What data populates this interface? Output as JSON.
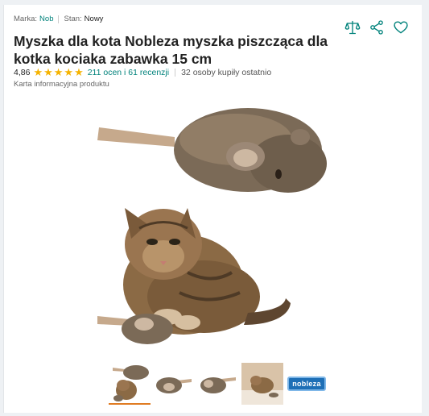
{
  "meta": {
    "brand_label": "Marka:",
    "brand": "Nob",
    "condition_label": "Stan:",
    "condition": "Nowy"
  },
  "product": {
    "title": "Myszka dla kota Nobleza myszka piszcząca dla kotka kociaka zabawka 15 cm",
    "rating": "4,86",
    "stars": 5,
    "reviews": "211 ocen i 61 recenzji",
    "bought": "32 osoby kupiły ostatnio",
    "info_link": "Karta informacyjna produktu"
  },
  "thumbnails": {
    "logo_text": "nobleza"
  },
  "colors": {
    "accent": "#00827b",
    "star": "#f5b301",
    "active_thumb": "#e07b22"
  },
  "icons": [
    "compare-icon",
    "share-icon",
    "heart-icon"
  ]
}
